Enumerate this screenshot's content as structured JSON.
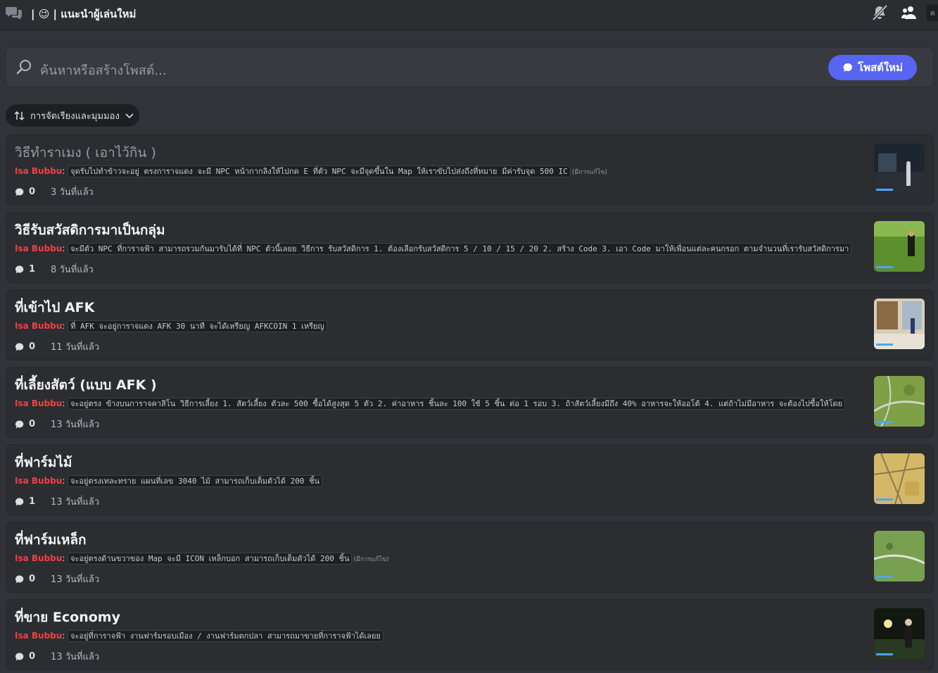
{
  "header": {
    "channel": "| 😉 | แนะนำผู้เล่นใหม่",
    "search_stub": "ค"
  },
  "search": {
    "placeholder": "ค้นหาหรือสร้างโพสต์...",
    "new_post_label": "โพสต์ใหม่"
  },
  "sort": {
    "label": "การจัดเรียงและมุมมอง"
  },
  "posts": [
    {
      "title": "วิธีทำราเมง ( เอาไว้กิน )",
      "author": "Isa Bubbu",
      "content": "จุดรับไปทำข้าวจะอยู่ ตรงการาจแดง จะมี NPC หน้ากากลิงให้ไปกด E ที่ตัว NPC จะมีจุดขึ้นใน Map ให้เราขับไปส่งถึงที่หมาย มีค่ารับจุด 500 IC",
      "edited": "(มีการแก้ไข)",
      "replies": "0",
      "time": "3 วันที่แล้ว",
      "read": true
    },
    {
      "title": "วิธีรับสวัสดิการมาเป็นกลุ่ม",
      "author": "Isa Bubbu",
      "content": "จะมีตัว NPC ที่การาจฟ้า สามารถรวมกันมารับได้ที่ NPC ตัวนี้เลยย วิธีการ รับสวัสดิการ 1. ต้องเลือกรับสวัสดิการ 5 / 10 / 15 / 20 2. สร้าง Code 3. เอา Code มาให้เพื่อนแต่ละคนกรอก ตามจำนวนที่เรารับสวัสดิการมา",
      "edited": "",
      "replies": "1",
      "time": "8 วันที่แล้ว",
      "read": false
    },
    {
      "title": "ที่เข้าไป AFK",
      "author": "Isa Bubbu",
      "content": "ที่ AFK จะอยู่การาจแดง AFK 30 นาที จะได้เหรียญ AFKCOIN 1 เหรียญ",
      "edited": "",
      "replies": "0",
      "time": "11 วันที่แล้ว",
      "read": false
    },
    {
      "title": "ที่เลี้ยงสัตว์ (แบบ AFK )",
      "author": "Isa Bubbu",
      "content": "จะอยู่ตรง ข้างบนการาจคาสิโน วิธีการเลี้ยง 1. สัตว์เลี้ยง ตัวละ 500 ซื้อได้สูงสุด 5 ตัว 2. ค่าอาหาร ชิ้นละ 100 ใช้ 5 ชิ้น ต่อ 1 รอบ 3. ถ้าสัตว์เลี้ยงมีถึง 40% อาหารจะให้ออโต้ 4. แต่ถ้าไม่มีอาหาร จะต้องไปซื้อให้โดย",
      "edited": "",
      "replies": "0",
      "time": "13 วันที่แล้ว",
      "read": false
    },
    {
      "title": "ที่ฟาร์มไม้",
      "author": "Isa Bubbu",
      "content": "จะอยู่ตรงเทละทราย แผนที่เลข 3040 ไม้ สามารถเก็บเต็มตัวได้ 200 ชิ้น",
      "edited": "",
      "replies": "1",
      "time": "13 วันที่แล้ว",
      "read": false
    },
    {
      "title": "ที่ฟาร์มเหล็ก",
      "author": "Isa Bubbu",
      "content": "จะอยู่ตรงด้านขวาของ Map จะมี ICON เหล็กบอก สามารถเก็บเต็มตัวได้ 200 ชิ้น",
      "edited": "(มีการแก้ไข)",
      "replies": "0",
      "time": "13 วันที่แล้ว",
      "read": false
    },
    {
      "title": "ที่ขาย Economy",
      "author": "Isa Bubbu",
      "content": "จะอยู่ที่การาจฟ้า งานฟาร์มรอบเมือง / งานฟาร์มตกปลา  สามารถมาขายที่การาจฟ้าได้เลยย",
      "edited": "",
      "replies": "0",
      "time": "13 วันที่แล้ว",
      "read": false
    }
  ],
  "colors": {
    "background": "#313338",
    "card": "#2b2d31",
    "accent": "#5865f2",
    "author": "#f23f42"
  }
}
